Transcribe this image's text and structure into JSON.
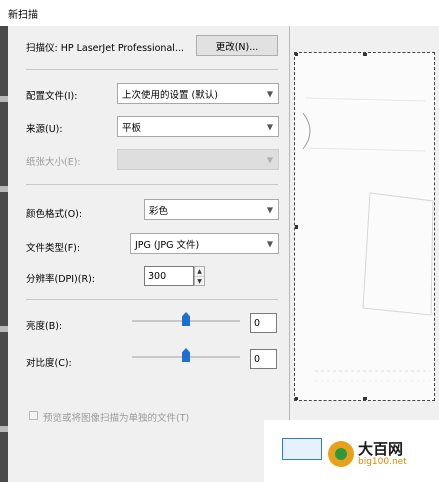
{
  "window": {
    "title": "新扫描"
  },
  "scanner": {
    "label": "扫描仪: HP LaserJet Professional...",
    "change_button": "更改(N)..."
  },
  "profile": {
    "label": "配置文件(I):",
    "value": "上次使用的设置 (默认)"
  },
  "source": {
    "label": "来源(U):",
    "value": "平板"
  },
  "paper_size": {
    "label": "纸张大小(E):",
    "value": ""
  },
  "color_format": {
    "label": "颜色格式(O):",
    "value": "彩色"
  },
  "file_type": {
    "label": "文件类型(F):",
    "value": "JPG (JPG 文件)"
  },
  "resolution": {
    "label": "分辨率(DPI)(R):",
    "value": "300"
  },
  "brightness": {
    "label": "亮度(B):",
    "value": "0",
    "level": 0
  },
  "contrast": {
    "label": "对比度(C):",
    "value": "0",
    "level": 0
  },
  "preview_separate": {
    "label": "预览或将图像扫描为单独的文件(T)",
    "checked": false
  },
  "watermark": {
    "name": "大百网",
    "url": "big100.net"
  },
  "icons": {
    "dropdown": "chevron-down-icon",
    "spin_up": "spin-up-icon",
    "spin_down": "spin-down-icon"
  },
  "colors": {
    "accent": "#1e6fd0"
  }
}
